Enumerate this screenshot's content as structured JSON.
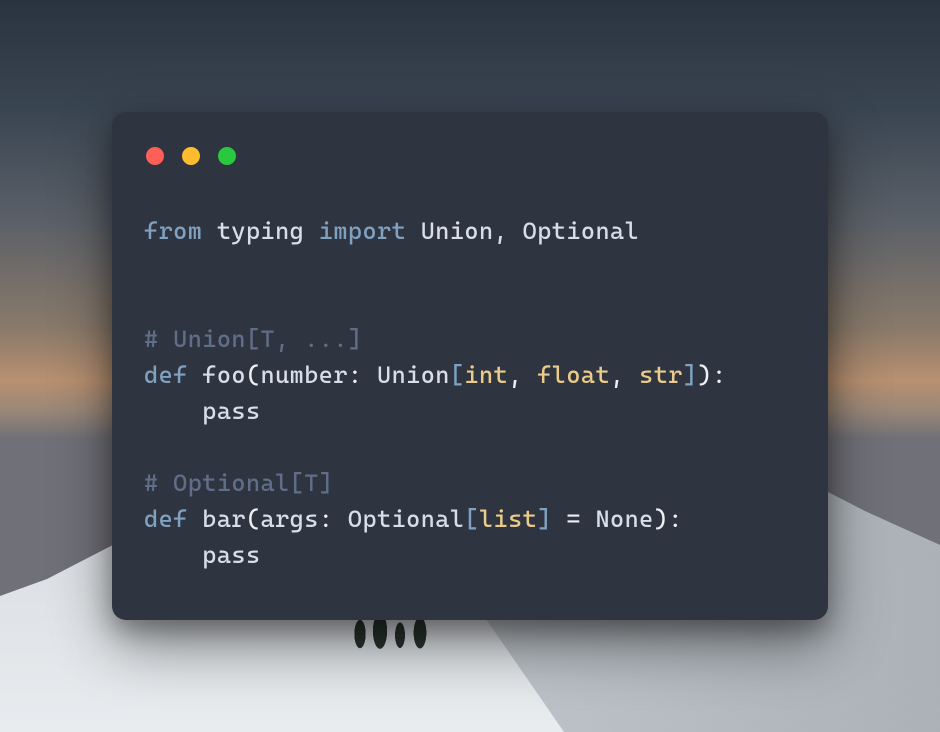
{
  "window": {
    "traffic_lights": [
      "close",
      "minimize",
      "zoom"
    ]
  },
  "code": {
    "line1": {
      "from": "from",
      "module": "typing",
      "import": "import",
      "names": "Union, Optional"
    },
    "line3_comment": "# Union[T, ...]",
    "line4": {
      "def": "def",
      "fname": "foo",
      "open": "(",
      "param": "number",
      "colon": ":",
      "annot": "Union",
      "bopen": "[",
      "t1": "int",
      "c1": ",",
      "t2": "float",
      "c2": ",",
      "t3": "str",
      "bclose": "]",
      "close": ")",
      "fcolon": ":"
    },
    "line5_pass": "    pass",
    "line7_comment": "# Optional[T]",
    "line8": {
      "def": "def",
      "fname": "bar",
      "open": "(",
      "param": "args",
      "colon": ":",
      "annot": "Optional",
      "bopen": "[",
      "t1": "list",
      "bclose": "]",
      "eq": " = ",
      "default": "None",
      "close": ")",
      "fcolon": ":"
    },
    "line9_pass": "    pass"
  }
}
